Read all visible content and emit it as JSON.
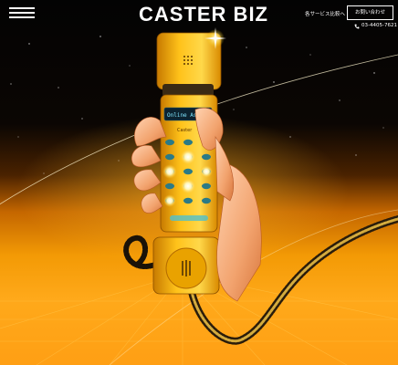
{
  "header": {
    "menu_icon": "hamburger-menu-icon",
    "logo": "CASTER BIZ",
    "compare_link": "各サービス比較へ",
    "contact_button": "お問い合わせ",
    "phone_icon": "phone-icon",
    "phone_number": "03-4405-7621"
  },
  "hero": {
    "handset_screen_text": "Online Assi",
    "handset_label": "Caster",
    "colors": {
      "handset": "#ffc21a",
      "handset_shadow": "#d98a00",
      "glow": "#fff3b0",
      "sky": "#000000",
      "horizon": "#f39a05"
    }
  }
}
